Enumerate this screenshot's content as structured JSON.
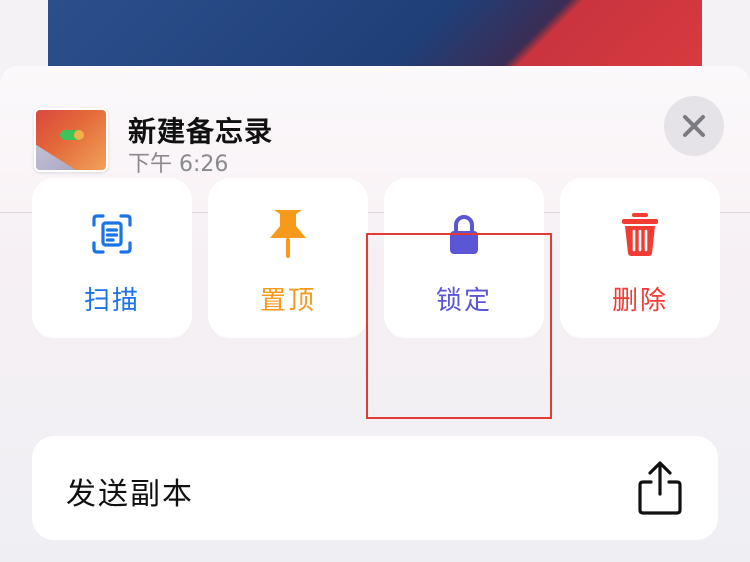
{
  "note": {
    "title": "新建备忘录",
    "time": "下午 6:26"
  },
  "actions": [
    {
      "label": "扫描",
      "icon": "scan-document-icon",
      "color": "#1a73e8"
    },
    {
      "label": "置顶",
      "icon": "pin-icon",
      "color": "#f59a1b"
    },
    {
      "label": "锁定",
      "icon": "lock-icon",
      "color": "#5a56d6"
    },
    {
      "label": "删除",
      "icon": "trash-icon",
      "color": "#f23b33"
    }
  ],
  "send_copy": {
    "label": "发送副本",
    "icon": "share-icon"
  },
  "close": {
    "icon": "close-icon"
  },
  "highlight_color": "#e23a35"
}
